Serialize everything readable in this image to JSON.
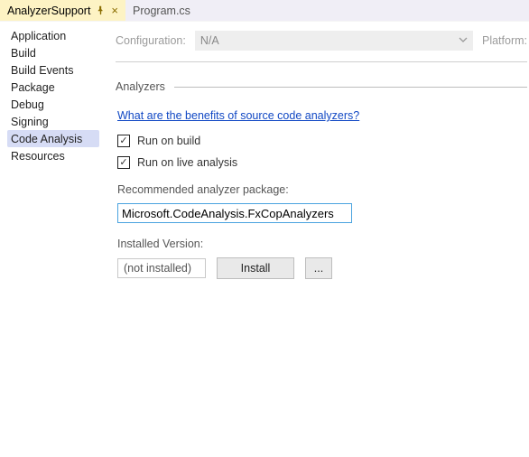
{
  "tabs": {
    "active": {
      "label": "AnalyzerSupport"
    },
    "inactive": {
      "label": "Program.cs"
    }
  },
  "sidebar": {
    "items": [
      {
        "label": "Application"
      },
      {
        "label": "Build"
      },
      {
        "label": "Build Events"
      },
      {
        "label": "Package"
      },
      {
        "label": "Debug"
      },
      {
        "label": "Signing"
      },
      {
        "label": "Code Analysis"
      },
      {
        "label": "Resources"
      }
    ],
    "selected_index": 6
  },
  "config": {
    "label": "Configuration:",
    "value": "N/A",
    "platform_label": "Platform:"
  },
  "analyzers": {
    "heading": "Analyzers",
    "benefits_link": "What are the benefits of source code analyzers?",
    "run_build_label": "Run on build",
    "run_build_checked": true,
    "run_live_label": "Run on live analysis",
    "run_live_checked": true,
    "recommended_label": "Recommended analyzer package:",
    "package_value": "Microsoft.CodeAnalysis.FxCopAnalyzers",
    "installed_label": "Installed Version:",
    "installed_value": "(not installed)",
    "install_button": "Install",
    "more_button": "..."
  }
}
